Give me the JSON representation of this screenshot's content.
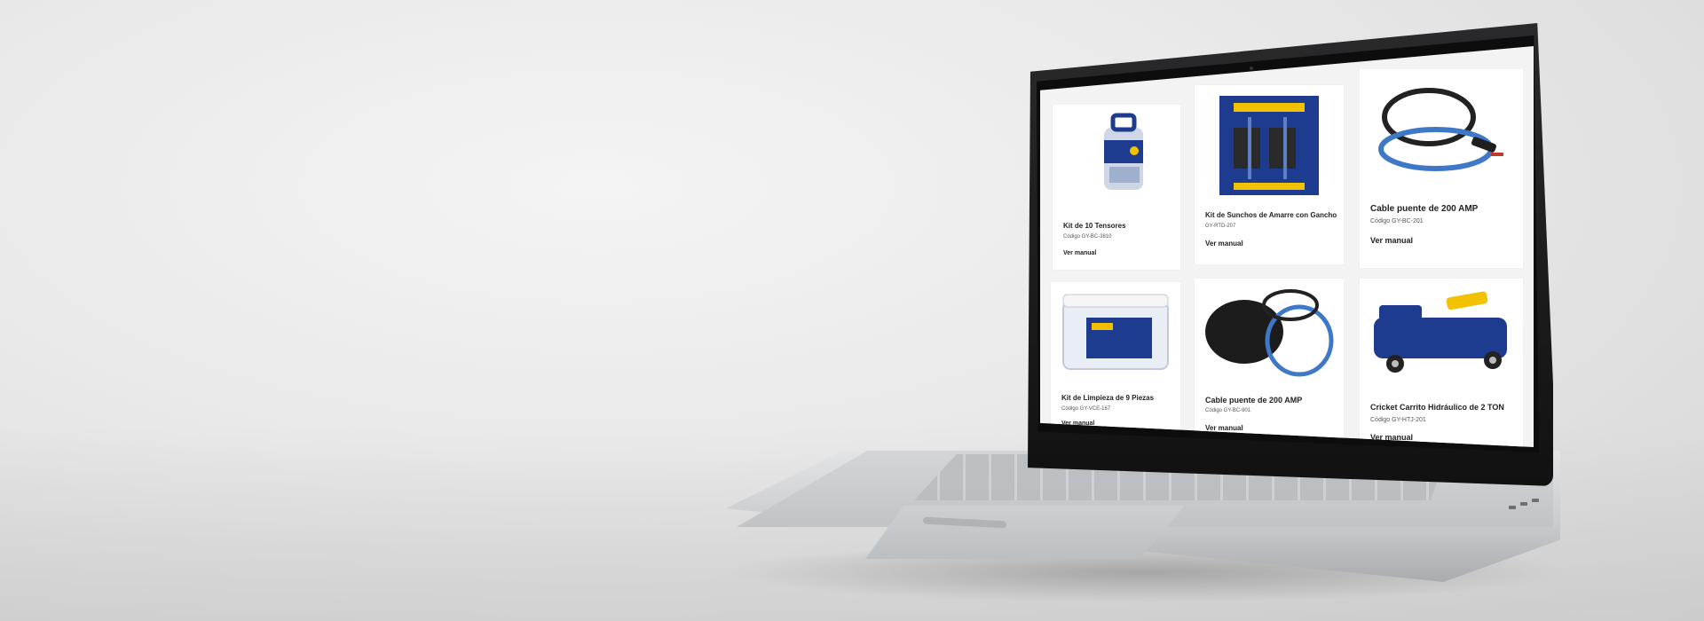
{
  "products": [
    {
      "name": "Kit de 10 Tensores",
      "code": "Código GY-BC-3810",
      "link": "Ver manual"
    },
    {
      "name": "Kit de Sunchos de Amarre con Gancho",
      "code": "GY-RTD-207",
      "link": "Ver manual"
    },
    {
      "name": "Cable puente de 200 AMP",
      "code": "Código GY-BC-201",
      "link": "Ver manual"
    },
    {
      "name": "Kit de Limpieza de 9 Piezas",
      "code": "Código GY-VCE-167",
      "link": "Ver manual"
    },
    {
      "name": "Cable puente de 200 AMP",
      "code": "Código GY-BC-901",
      "link": "Ver manual"
    },
    {
      "name": "Cricket Carrito Hidráulico de 2 TON",
      "code": "Código GY-HTJ-201",
      "link": "Ver manual"
    }
  ],
  "colors": {
    "brand_blue": "#1d3c8f",
    "brand_yellow": "#f2c200"
  }
}
